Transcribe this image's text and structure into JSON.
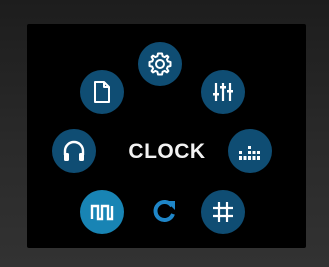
{
  "center_label": "CLOCK",
  "colors": {
    "button": "#0f4d73",
    "button_active": "#1884b4",
    "icon": "#ffffff",
    "reset_icon": "#1f86c8"
  },
  "menu": [
    {
      "id": "settings",
      "icon": "gear-icon",
      "active": false
    },
    {
      "id": "mixer",
      "icon": "sliders-icon",
      "active": false
    },
    {
      "id": "equalizer",
      "icon": "equalizer-icon",
      "active": false
    },
    {
      "id": "grid",
      "icon": "grid-icon",
      "active": false
    },
    {
      "id": "reset",
      "icon": "refresh-icon",
      "active": false
    },
    {
      "id": "clock-wave",
      "icon": "square-wave-icon",
      "active": true
    },
    {
      "id": "headphones",
      "icon": "headphones-icon",
      "active": false
    },
    {
      "id": "file",
      "icon": "document-icon",
      "active": false
    }
  ]
}
